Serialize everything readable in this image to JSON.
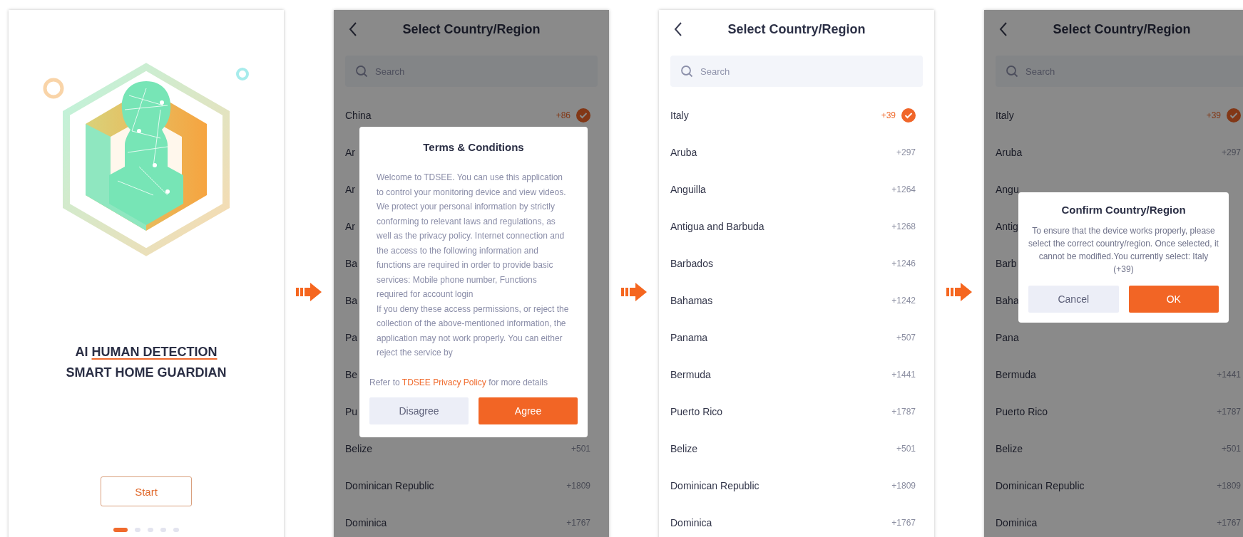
{
  "screens": [
    {
      "kind": "intro",
      "headline": [
        {
          "text": "AI ",
          "underlined": false
        },
        {
          "text": "HUMAN DETECTION",
          "underlined": true
        }
      ],
      "subheadline": "SMART HOME GUARDIAN",
      "start_button": "Start",
      "pager": [
        {
          "selected": true
        },
        {
          "selected": false
        },
        {
          "selected": false
        },
        {
          "selected": false
        },
        {
          "selected": false
        }
      ]
    },
    {
      "kind": "list",
      "title": "Select Country/Region",
      "search": {
        "placeholder": "Search"
      },
      "rows": [
        {
          "name": "China",
          "code": "+86",
          "selected": true
        },
        {
          "name": "Ar"
        },
        {
          "name": "Ar"
        },
        {
          "name": "Ar"
        },
        {
          "name": "Ba"
        },
        {
          "name": "Ba"
        },
        {
          "name": "Pa"
        },
        {
          "name": "Be"
        },
        {
          "name": "Pu"
        },
        {
          "name": "Belize",
          "code": "+501",
          "selected": false
        },
        {
          "name": "Dominican Republic",
          "code": "+1809",
          "selected": false
        },
        {
          "name": "Dominica",
          "code": "+1767",
          "selected": false
        }
      ],
      "dialog": {
        "kind": "terms",
        "title": "Terms & Conditions",
        "paragraphs": [
          "Welcome to TDSEE. You can use this application to control your monitoring device and view videos.",
          "We protect your personal information by strictly conforming to relevant laws and regulations, as well as the privacy policy. Internet connection and the access to the following information and functions are required in order to provide basic services: Mobile phone number, Functions required for account login",
          "If you deny these access permissions, or reject the collection of the above-mentioned information, the application may not work properly. You can either reject the service by"
        ],
        "footer": {
          "before": "Refer to ",
          "link": "TDSEE Privacy Policy",
          "after": " for more details"
        },
        "buttons": [
          {
            "label": "Disagree",
            "primary": false
          },
          {
            "label": "Agree",
            "primary": true
          }
        ]
      }
    },
    {
      "kind": "list",
      "title": "Select Country/Region",
      "search": {
        "placeholder": "Search"
      },
      "rows": [
        {
          "name": "Italy",
          "code": "+39",
          "selected": true
        },
        {
          "name": "Aruba",
          "code": "+297",
          "selected": false
        },
        {
          "name": "Anguilla",
          "code": "+1264",
          "selected": false
        },
        {
          "name": "Antigua and Barbuda",
          "code": "+1268",
          "selected": false
        },
        {
          "name": "Barbados",
          "code": "+1246",
          "selected": false
        },
        {
          "name": "Bahamas",
          "code": "+1242",
          "selected": false
        },
        {
          "name": "Panama",
          "code": "+507",
          "selected": false
        },
        {
          "name": "Bermuda",
          "code": "+1441",
          "selected": false
        },
        {
          "name": "Puerto Rico",
          "code": "+1787",
          "selected": false
        },
        {
          "name": "Belize",
          "code": "+501",
          "selected": false
        },
        {
          "name": "Dominican Republic",
          "code": "+1809",
          "selected": false
        },
        {
          "name": "Dominica",
          "code": "+1767",
          "selected": false
        }
      ]
    },
    {
      "kind": "list",
      "title": "Select Country/Region",
      "search": {
        "placeholder": "Search"
      },
      "rows": [
        {
          "name": "Italy",
          "code": "+39",
          "selected": true
        },
        {
          "name": "Aruba",
          "code": "+297",
          "selected": false
        },
        {
          "name": "Angu"
        },
        {
          "name": "Antig"
        },
        {
          "name": "Barb"
        },
        {
          "name": "Baha"
        },
        {
          "name": "Pana"
        },
        {
          "name": "Bermuda",
          "code": "+1441",
          "selected": false
        },
        {
          "name": "Puerto Rico",
          "code": "+1787",
          "selected": false
        },
        {
          "name": "Belize",
          "code": "+501",
          "selected": false
        },
        {
          "name": "Dominican Republic",
          "code": "+1809",
          "selected": false
        },
        {
          "name": "Dominica",
          "code": "+1767",
          "selected": false
        }
      ],
      "dialog": {
        "kind": "confirm",
        "title": "Confirm Country/Region",
        "message": "To ensure that the device works properly, please select the correct country/region. Once selected, it cannot be modified.You currently select: Italy (+39)",
        "buttons": [
          {
            "label": "Cancel",
            "primary": false
          },
          {
            "label": "OK",
            "primary": true
          }
        ]
      }
    }
  ]
}
